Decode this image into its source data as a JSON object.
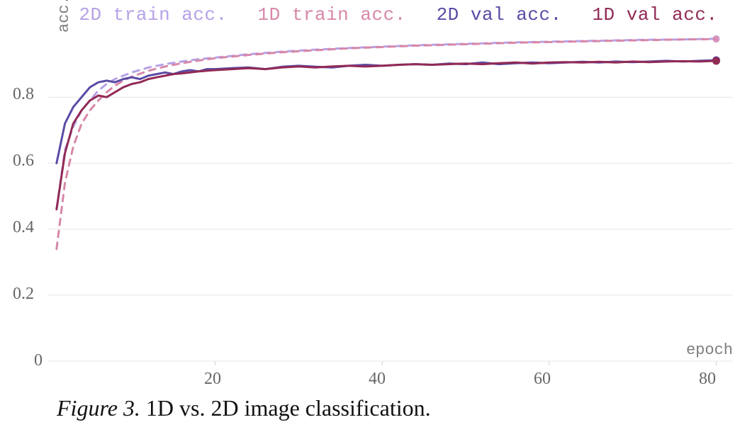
{
  "legend": {
    "s0": "2D train acc.",
    "s1": "1D train acc.",
    "s2": "2D val acc.",
    "s3": "1D val acc."
  },
  "colors": {
    "train2d": "#b6a1e6",
    "train1d": "#d787a9",
    "val2d": "#5a4ba6",
    "val1d": "#922a56"
  },
  "axes": {
    "ylabel": "acc.",
    "xlabel": "epoch",
    "xticks": [
      "20",
      "40",
      "60",
      "80"
    ],
    "yticks": [
      "0",
      "0.2",
      "0.4",
      "0.6",
      "0.8"
    ]
  },
  "caption": {
    "figlabel": "Figure 3.",
    "text": " 1D vs. 2D image classification."
  },
  "chart_data": {
    "type": "line",
    "xlabel": "epoch",
    "ylabel": "acc.",
    "xlim": [
      0,
      82
    ],
    "ylim": [
      0,
      1.0
    ],
    "xticks": [
      20,
      40,
      60,
      80
    ],
    "yticks": [
      0,
      0.2,
      0.4,
      0.6,
      0.8
    ],
    "grid": true,
    "legend_position": "top",
    "series": [
      {
        "name": "2D train acc.",
        "style": "dashed",
        "color": "#b6a1e6",
        "x": [
          1,
          2,
          3,
          4,
          5,
          6,
          7,
          8,
          9,
          10,
          12,
          14,
          16,
          18,
          20,
          24,
          28,
          32,
          36,
          40,
          44,
          48,
          52,
          56,
          60,
          64,
          68,
          72,
          76,
          80
        ],
        "y": [
          0.46,
          0.64,
          0.71,
          0.76,
          0.79,
          0.82,
          0.84,
          0.855,
          0.865,
          0.875,
          0.89,
          0.9,
          0.908,
          0.915,
          0.92,
          0.93,
          0.938,
          0.944,
          0.949,
          0.953,
          0.957,
          0.96,
          0.963,
          0.966,
          0.968,
          0.97,
          0.972,
          0.974,
          0.975,
          0.977
        ]
      },
      {
        "name": "1D train acc.",
        "style": "dashed",
        "color": "#d787a9",
        "x": [
          1,
          2,
          3,
          4,
          5,
          6,
          7,
          8,
          9,
          10,
          12,
          14,
          16,
          18,
          20,
          24,
          28,
          32,
          36,
          40,
          44,
          48,
          52,
          56,
          60,
          64,
          68,
          72,
          76,
          80
        ],
        "y": [
          0.34,
          0.54,
          0.65,
          0.72,
          0.76,
          0.79,
          0.815,
          0.835,
          0.85,
          0.862,
          0.88,
          0.893,
          0.903,
          0.911,
          0.918,
          0.928,
          0.936,
          0.942,
          0.948,
          0.952,
          0.956,
          0.959,
          0.962,
          0.965,
          0.967,
          0.969,
          0.971,
          0.973,
          0.975,
          0.976
        ]
      },
      {
        "name": "2D val acc.",
        "style": "solid",
        "color": "#5a4ba6",
        "x": [
          1,
          2,
          3,
          4,
          5,
          6,
          7,
          8,
          9,
          10,
          11,
          12,
          13,
          14,
          15,
          16,
          17,
          18,
          19,
          20,
          22,
          24,
          26,
          28,
          30,
          32,
          34,
          36,
          38,
          40,
          42,
          44,
          46,
          48,
          50,
          52,
          54,
          56,
          58,
          60,
          62,
          64,
          66,
          68,
          70,
          72,
          74,
          76,
          78,
          80
        ],
        "y": [
          0.6,
          0.72,
          0.77,
          0.8,
          0.83,
          0.845,
          0.85,
          0.845,
          0.855,
          0.86,
          0.855,
          0.865,
          0.87,
          0.875,
          0.87,
          0.878,
          0.882,
          0.878,
          0.885,
          0.885,
          0.888,
          0.89,
          0.885,
          0.892,
          0.895,
          0.892,
          0.89,
          0.895,
          0.898,
          0.895,
          0.898,
          0.9,
          0.898,
          0.902,
          0.9,
          0.905,
          0.9,
          0.903,
          0.905,
          0.903,
          0.905,
          0.907,
          0.905,
          0.908,
          0.906,
          0.908,
          0.91,
          0.908,
          0.91,
          0.912
        ]
      },
      {
        "name": "1D val acc.",
        "style": "solid",
        "color": "#922a56",
        "x": [
          1,
          2,
          3,
          4,
          5,
          6,
          7,
          8,
          9,
          10,
          11,
          12,
          13,
          14,
          15,
          16,
          17,
          18,
          19,
          20,
          22,
          24,
          26,
          28,
          30,
          32,
          34,
          36,
          38,
          40,
          42,
          44,
          46,
          48,
          50,
          52,
          54,
          56,
          58,
          60,
          62,
          64,
          66,
          68,
          70,
          72,
          74,
          76,
          78,
          80
        ],
        "y": [
          0.46,
          0.63,
          0.72,
          0.76,
          0.79,
          0.805,
          0.8,
          0.815,
          0.83,
          0.84,
          0.845,
          0.855,
          0.86,
          0.865,
          0.87,
          0.872,
          0.875,
          0.878,
          0.88,
          0.882,
          0.885,
          0.888,
          0.885,
          0.89,
          0.893,
          0.89,
          0.893,
          0.895,
          0.893,
          0.895,
          0.898,
          0.9,
          0.898,
          0.9,
          0.902,
          0.9,
          0.903,
          0.905,
          0.902,
          0.905,
          0.906,
          0.905,
          0.907,
          0.905,
          0.908,
          0.906,
          0.908,
          0.909,
          0.908,
          0.91
        ]
      }
    ]
  }
}
